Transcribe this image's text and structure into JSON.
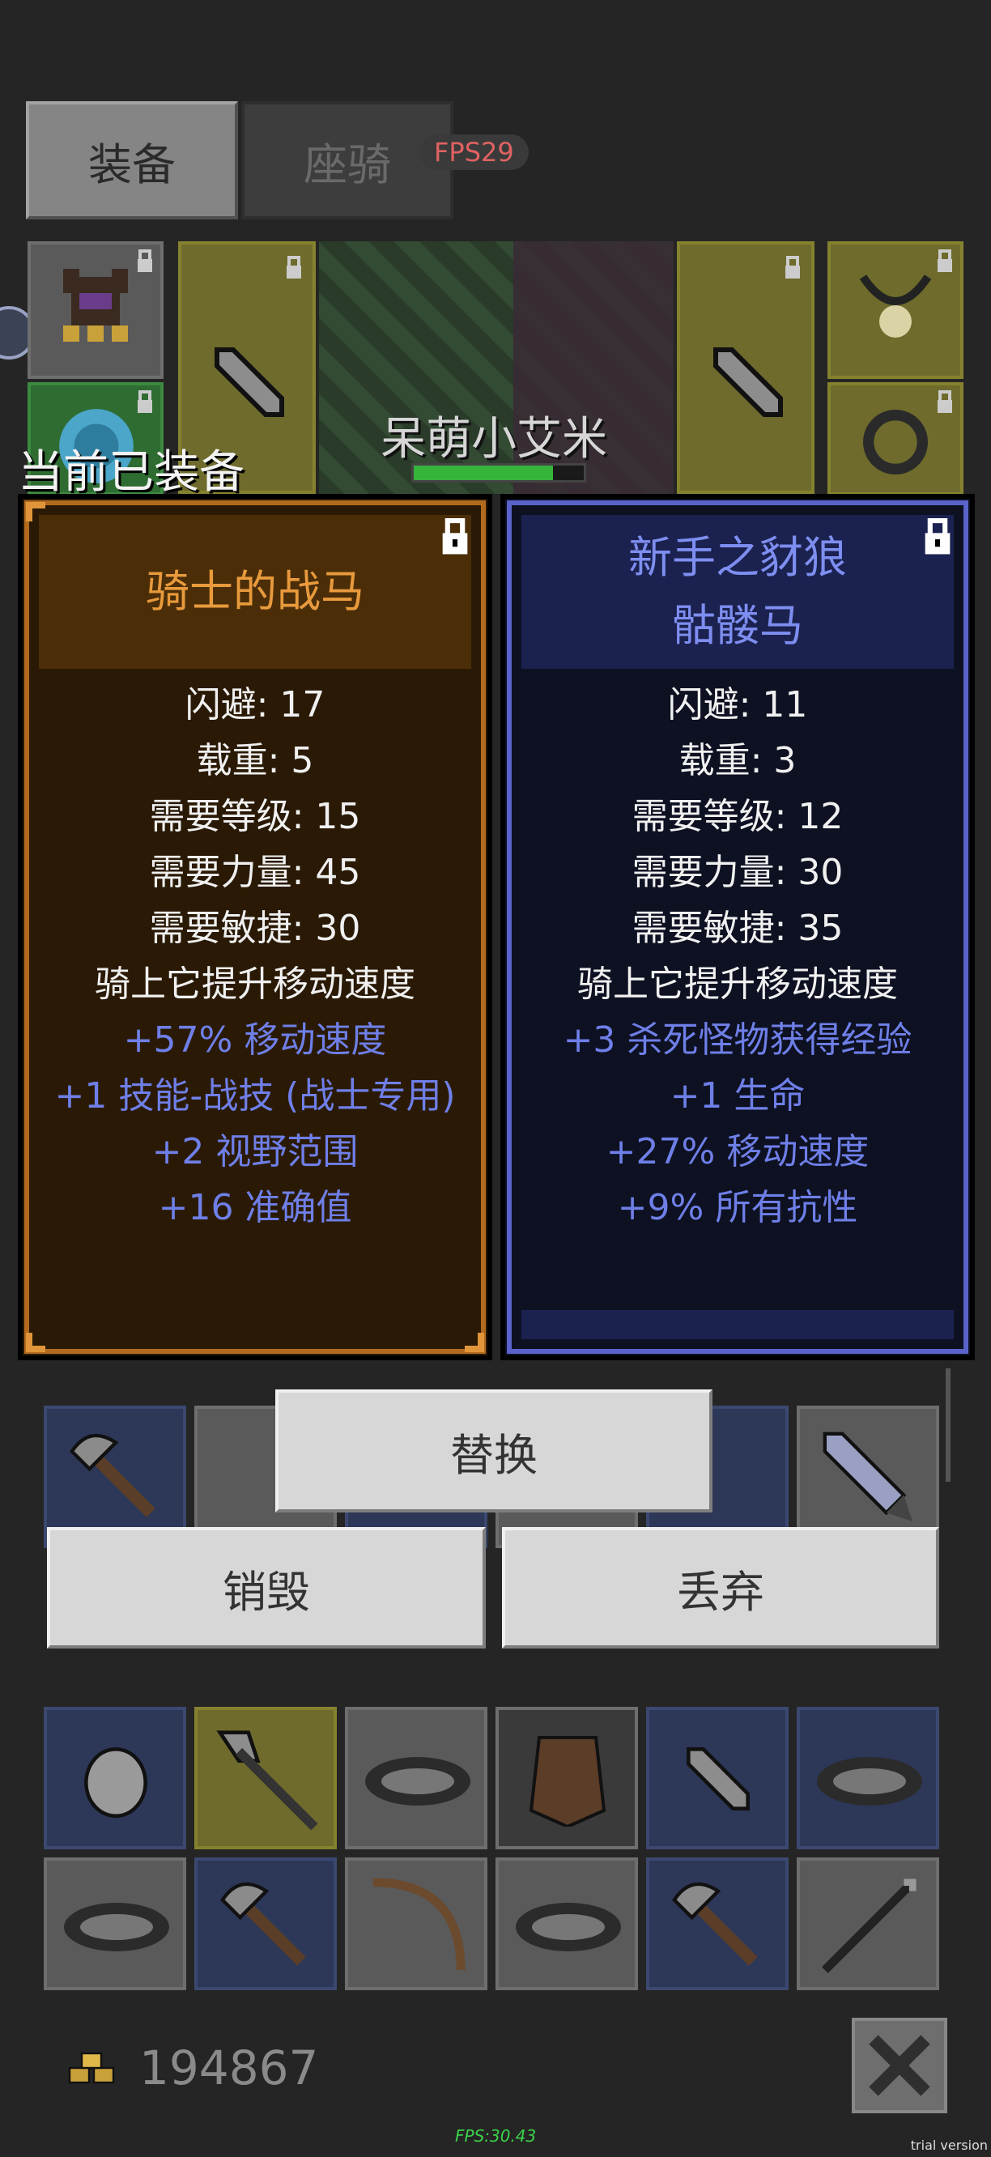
{
  "tabs": {
    "equipment": "装备",
    "mount": "座骑"
  },
  "fps_badge": "FPS29",
  "character_name": "呆萌小艾米",
  "equipped_label": "当前已装备",
  "card_left": {
    "title": "骑士的战马",
    "stats": [
      "闪避: 17",
      "载重: 5",
      "需要等级: 15",
      "需要力量: 45",
      "需要敏捷: 30",
      "骑上它提升移动速度"
    ],
    "magic_stats": [
      "+57% 移动速度",
      "+1 技能-战技 (战士专用)",
      "+2 视野范围",
      "+16 准确值"
    ]
  },
  "card_right": {
    "title_line1": "新手之豺狼",
    "title_line2": "骷髅马",
    "stats": [
      "闪避: 11",
      "载重: 3",
      "需要等级: 12",
      "需要力量: 30",
      "需要敏捷: 35",
      "骑上它提升移动速度"
    ],
    "magic_stats": [
      "+3 杀死怪物获得经验",
      "+1 生命",
      "+27% 移动速度",
      "+9% 所有抗性"
    ]
  },
  "buttons": {
    "replace": "替换",
    "destroy": "销毁",
    "discard": "丢弃"
  },
  "gold": "194867",
  "fps_bottom": "FPS:30.43",
  "watermark": "trial version",
  "colors": {
    "left_accent": "#b26a1e",
    "right_accent": "#5a63c9",
    "magic_text": "#6f7fe8"
  }
}
